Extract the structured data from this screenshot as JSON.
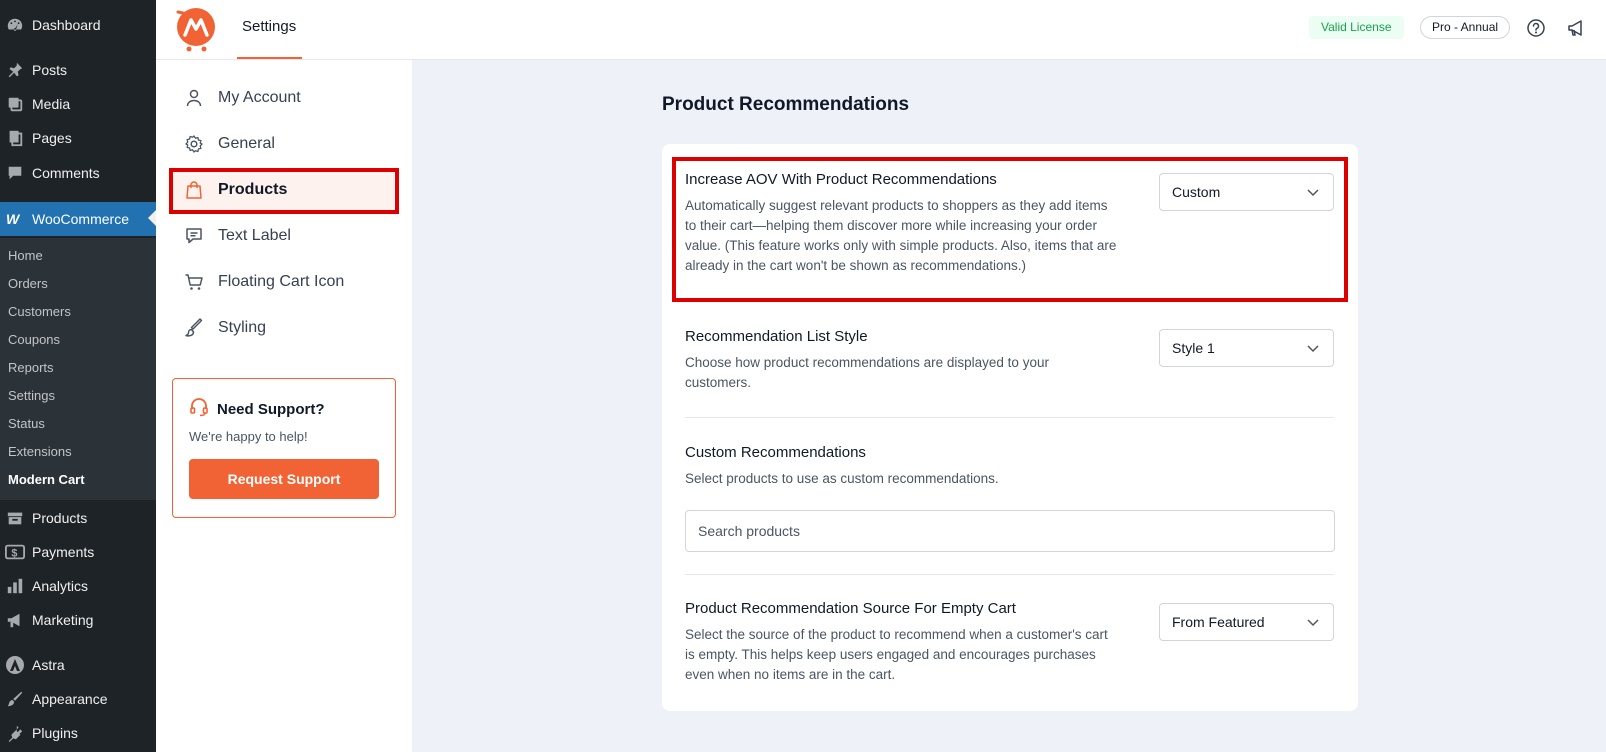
{
  "wp_menu": {
    "dashboard": "Dashboard",
    "posts": "Posts",
    "media": "Media",
    "pages": "Pages",
    "comments": "Comments",
    "woocommerce": "WooCommerce",
    "submenu": [
      "Home",
      "Orders",
      "Customers",
      "Coupons",
      "Reports",
      "Settings",
      "Status",
      "Extensions",
      "Modern Cart"
    ],
    "products": "Products",
    "payments": "Payments",
    "analytics": "Analytics",
    "marketing": "Marketing",
    "astra": "Astra",
    "appearance": "Appearance",
    "plugins": "Plugins"
  },
  "header": {
    "title": "Settings",
    "license_badge": "Valid License",
    "plan_badge": "Pro - Annual"
  },
  "settings_nav": {
    "items": [
      "My Account",
      "General",
      "Products",
      "Text Label",
      "Floating Cart Icon",
      "Styling"
    ],
    "active": "Products"
  },
  "support": {
    "title": "Need Support?",
    "subtitle": "We're happy to help!",
    "button": "Request Support"
  },
  "main": {
    "heading": "Product Recommendations",
    "aov": {
      "title": "Increase AOV With Product Recommendations",
      "desc_lines": [
        "Automatically suggest relevant products to shoppers as they add items",
        "to their cart—helping them discover more while increasing your order",
        "value. (This feature works only with simple products. Also, items that are",
        "already in the cart won't be shown as recommendations.)"
      ],
      "value": "Custom"
    },
    "list_style": {
      "title": "Recommendation List Style",
      "desc_lines": [
        "Choose how product recommendations are displayed to your",
        "customers."
      ],
      "value": "Style 1"
    },
    "custom": {
      "title": "Custom Recommendations",
      "desc": "Select products to use as custom recommendations.",
      "search_placeholder": "Search products"
    },
    "empty_cart": {
      "title": "Product Recommendation Source For Empty Cart",
      "desc_lines": [
        "Select the source of the product to recommend when a customer's cart",
        "is empty. This helps keep users engaged and encourages purchases",
        "even when no items are in the cart."
      ],
      "value": "From Featured"
    }
  }
}
